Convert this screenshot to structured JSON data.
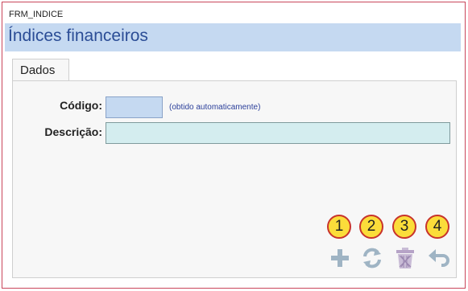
{
  "window": {
    "title": "FRM_INDICE"
  },
  "header": {
    "title": "Índices financeiros"
  },
  "tabs": [
    {
      "label": "Dados"
    }
  ],
  "form": {
    "codigo": {
      "label": "Código:",
      "value": "",
      "hint": "(obtido automaticamente)"
    },
    "descricao": {
      "label": "Descrição:",
      "value": ""
    }
  },
  "annotations": [
    "1",
    "2",
    "3",
    "4"
  ],
  "toolbar": {
    "buttons": [
      {
        "icon": "plus-icon"
      },
      {
        "icon": "refresh-icon"
      },
      {
        "icon": "trash-icon"
      },
      {
        "icon": "undo-icon"
      }
    ]
  },
  "colors": {
    "header_bg": "#c5d9f1",
    "header_text": "#2b4d96",
    "codigo_bg": "#c5d9f1",
    "descricao_bg": "#d4edef",
    "badge_fill": "#fbdd3a",
    "badge_border": "#c8332c",
    "icon_color": "#9fb4c4"
  }
}
